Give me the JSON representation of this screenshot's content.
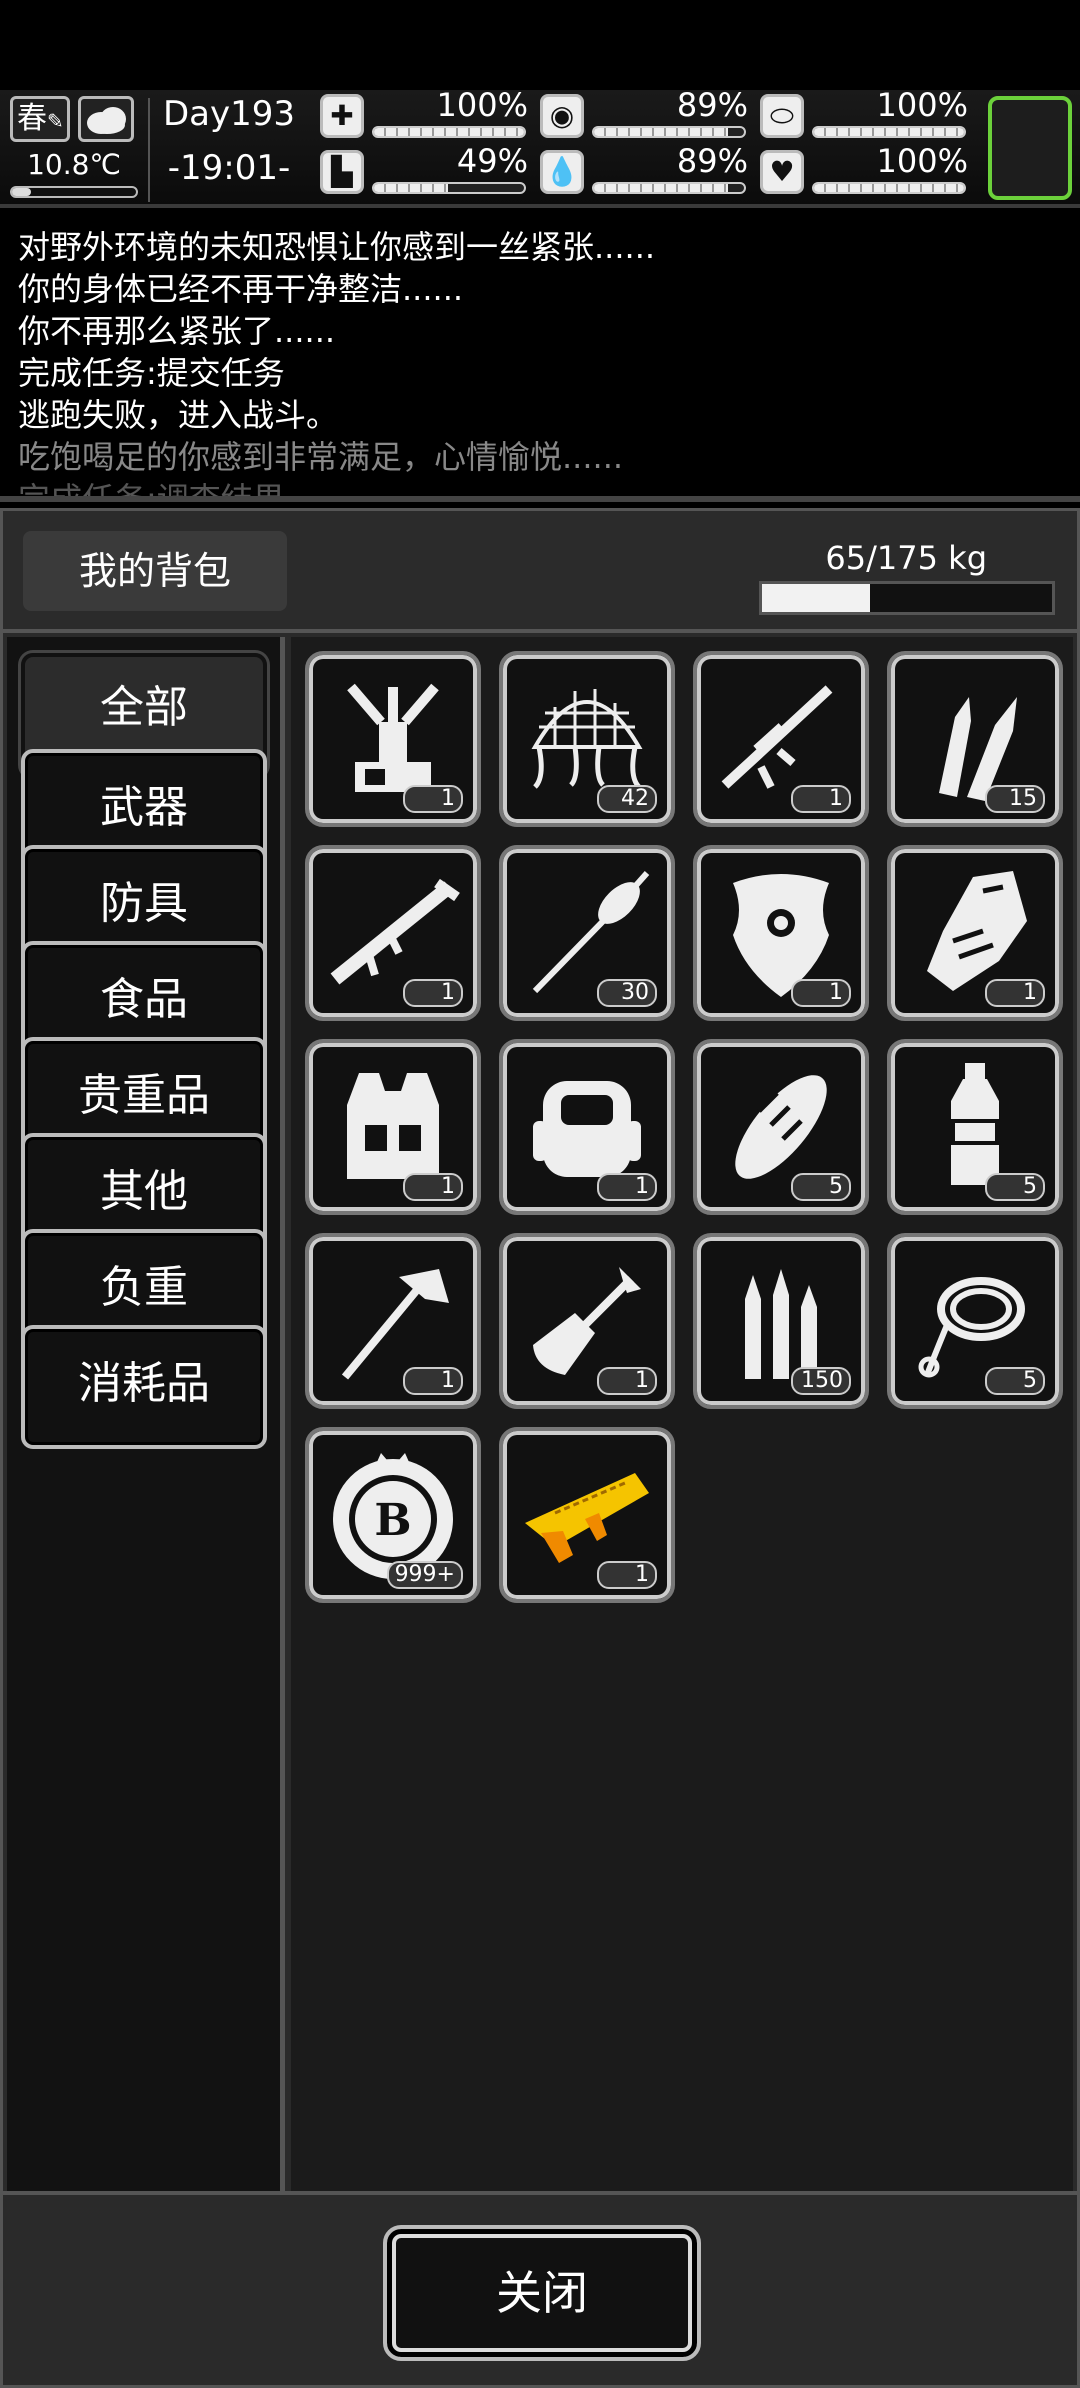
{
  "status": {
    "season": "春",
    "temperature": "10.8℃",
    "temperature_level": 0.15,
    "day": "Day193",
    "clock": "-19:01-",
    "stats": [
      {
        "name": "health",
        "icon": "medkit-icon",
        "value": "100%",
        "level": 1.0
      },
      {
        "name": "hunger",
        "icon": "stomach-icon",
        "value": "89%",
        "level": 0.89
      },
      {
        "name": "energy",
        "icon": "pill-icon",
        "value": "100%",
        "level": 1.0
      },
      {
        "name": "stamina",
        "icon": "boot-icon",
        "value": "49%",
        "level": 0.49
      },
      {
        "name": "thirst",
        "icon": "water-drop-icon",
        "value": "89%",
        "level": 0.89
      },
      {
        "name": "mood",
        "icon": "heart-icon",
        "value": "100%",
        "level": 1.0
      }
    ],
    "accent_color": "#6cd13b"
  },
  "log": [
    "对野外环境的未知恐惧让你感到一丝紧张......",
    "你的身体已经不再干净整洁......",
    "你不再那么紧张了......",
    "完成任务:提交任务",
    "逃跑失败，进入战斗。",
    "吃饱喝足的你感到非常满足，心情愉悦......",
    "完成任务:调查结果"
  ],
  "inventory": {
    "title": "我的背包",
    "weight": "65/175 kg",
    "weight_level": 0.371,
    "categories": [
      "全部",
      "武器",
      "防具",
      "食品",
      "贵重品",
      "其他",
      "负重",
      "消耗品"
    ],
    "active_category": "全部",
    "items": [
      {
        "icon": "mount-tool-icon",
        "count": "1"
      },
      {
        "icon": "net-icon",
        "count": "42"
      },
      {
        "icon": "sniper-rifle-icon",
        "count": "1"
      },
      {
        "icon": "bullets-icon",
        "count": "15"
      },
      {
        "icon": "rocket-launcher-icon",
        "count": "1"
      },
      {
        "icon": "rocket-icon",
        "count": "30"
      },
      {
        "icon": "shield-icon",
        "count": "1"
      },
      {
        "icon": "gauntlet-icon",
        "count": "1"
      },
      {
        "icon": "tactical-vest-icon",
        "count": "1"
      },
      {
        "icon": "backpack-icon",
        "count": "1"
      },
      {
        "icon": "bread-icon",
        "count": "5"
      },
      {
        "icon": "water-bottle-icon",
        "count": "5"
      },
      {
        "icon": "axe-icon",
        "count": "1"
      },
      {
        "icon": "shovel-icon",
        "count": "1"
      },
      {
        "icon": "ammo-icon",
        "count": "150"
      },
      {
        "icon": "rope-icon",
        "count": "5"
      },
      {
        "icon": "coin-icon",
        "count": "999+"
      },
      {
        "icon": "gold-gun-icon",
        "count": "1"
      }
    ],
    "close_label": "关闭"
  }
}
